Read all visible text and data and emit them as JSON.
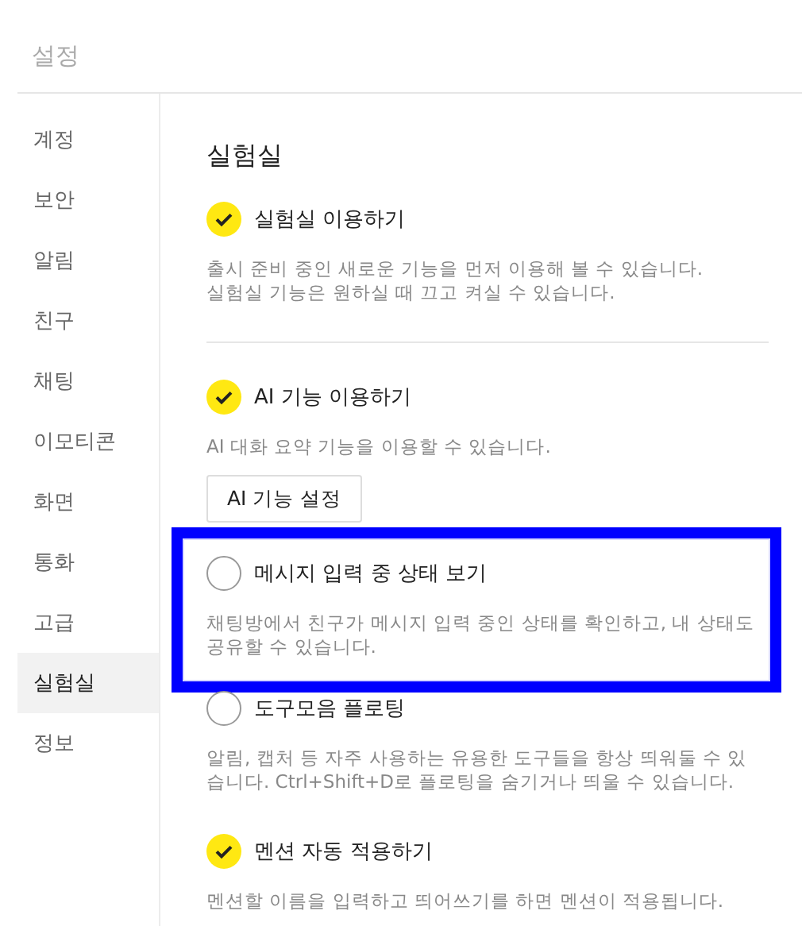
{
  "title": "설정",
  "sidebar": {
    "items": [
      {
        "label": "계정",
        "selected": false
      },
      {
        "label": "보안",
        "selected": false
      },
      {
        "label": "알림",
        "selected": false
      },
      {
        "label": "친구",
        "selected": false
      },
      {
        "label": "채팅",
        "selected": false
      },
      {
        "label": "이모티콘",
        "selected": false
      },
      {
        "label": "화면",
        "selected": false
      },
      {
        "label": "통화",
        "selected": false
      },
      {
        "label": "고급",
        "selected": false
      },
      {
        "label": "실험실",
        "selected": true
      },
      {
        "label": "정보",
        "selected": false
      }
    ]
  },
  "section": {
    "title": "실험실",
    "groups": [
      {
        "options": [
          {
            "label": "실험실 이용하기",
            "checked": true,
            "highlighted": false,
            "description": [
              "출시 준비 중인 새로운 기능을 먼저 이용해 볼 수 있습니다.",
              "실험실 기능은 원하실 때 끄고 켜실 수 있습니다."
            ]
          }
        ]
      },
      {
        "options": [
          {
            "label": "AI 기능 이용하기",
            "checked": true,
            "highlighted": false,
            "description": [
              "AI 대화 요약 기능을 이용할 수 있습니다."
            ],
            "button": "AI 기능 설정"
          },
          {
            "label": "메시지 입력 중 상태 보기",
            "checked": false,
            "highlighted": true,
            "description": [
              "채팅방에서 친구가 메시지 입력 중인 상태를 확인하고, 내 상태도 공유할 수 있습니다."
            ]
          },
          {
            "label": "도구모음 플로팅",
            "checked": false,
            "highlighted": false,
            "description": [
              "알림, 캡처 등 자주 사용하는 유용한 도구들을 항상 띄워둘 수 있습니다. Ctrl+Shift+D로 플로팅을 숨기거나 띄울 수 있습니다."
            ]
          },
          {
            "label": "멘션 자동 적용하기",
            "checked": true,
            "highlighted": false,
            "description": [
              "멘션할 이름을 입력하고 띄어쓰기를 하면 멘션이 적용됩니다."
            ]
          }
        ]
      }
    ]
  }
}
